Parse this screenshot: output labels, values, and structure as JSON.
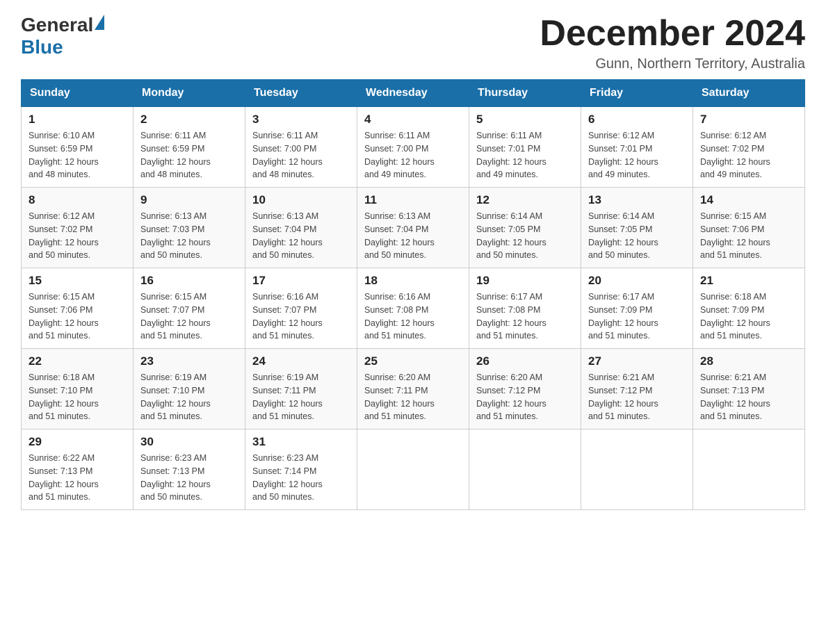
{
  "logo": {
    "general": "General",
    "blue": "Blue"
  },
  "title": "December 2024",
  "location": "Gunn, Northern Territory, Australia",
  "days_of_week": [
    "Sunday",
    "Monday",
    "Tuesday",
    "Wednesday",
    "Thursday",
    "Friday",
    "Saturday"
  ],
  "weeks": [
    [
      {
        "day": "1",
        "sunrise": "6:10 AM",
        "sunset": "6:59 PM",
        "daylight": "12 hours and 48 minutes."
      },
      {
        "day": "2",
        "sunrise": "6:11 AM",
        "sunset": "6:59 PM",
        "daylight": "12 hours and 48 minutes."
      },
      {
        "day": "3",
        "sunrise": "6:11 AM",
        "sunset": "7:00 PM",
        "daylight": "12 hours and 48 minutes."
      },
      {
        "day": "4",
        "sunrise": "6:11 AM",
        "sunset": "7:00 PM",
        "daylight": "12 hours and 49 minutes."
      },
      {
        "day": "5",
        "sunrise": "6:11 AM",
        "sunset": "7:01 PM",
        "daylight": "12 hours and 49 minutes."
      },
      {
        "day": "6",
        "sunrise": "6:12 AM",
        "sunset": "7:01 PM",
        "daylight": "12 hours and 49 minutes."
      },
      {
        "day": "7",
        "sunrise": "6:12 AM",
        "sunset": "7:02 PM",
        "daylight": "12 hours and 49 minutes."
      }
    ],
    [
      {
        "day": "8",
        "sunrise": "6:12 AM",
        "sunset": "7:02 PM",
        "daylight": "12 hours and 50 minutes."
      },
      {
        "day": "9",
        "sunrise": "6:13 AM",
        "sunset": "7:03 PM",
        "daylight": "12 hours and 50 minutes."
      },
      {
        "day": "10",
        "sunrise": "6:13 AM",
        "sunset": "7:04 PM",
        "daylight": "12 hours and 50 minutes."
      },
      {
        "day": "11",
        "sunrise": "6:13 AM",
        "sunset": "7:04 PM",
        "daylight": "12 hours and 50 minutes."
      },
      {
        "day": "12",
        "sunrise": "6:14 AM",
        "sunset": "7:05 PM",
        "daylight": "12 hours and 50 minutes."
      },
      {
        "day": "13",
        "sunrise": "6:14 AM",
        "sunset": "7:05 PM",
        "daylight": "12 hours and 50 minutes."
      },
      {
        "day": "14",
        "sunrise": "6:15 AM",
        "sunset": "7:06 PM",
        "daylight": "12 hours and 51 minutes."
      }
    ],
    [
      {
        "day": "15",
        "sunrise": "6:15 AM",
        "sunset": "7:06 PM",
        "daylight": "12 hours and 51 minutes."
      },
      {
        "day": "16",
        "sunrise": "6:15 AM",
        "sunset": "7:07 PM",
        "daylight": "12 hours and 51 minutes."
      },
      {
        "day": "17",
        "sunrise": "6:16 AM",
        "sunset": "7:07 PM",
        "daylight": "12 hours and 51 minutes."
      },
      {
        "day": "18",
        "sunrise": "6:16 AM",
        "sunset": "7:08 PM",
        "daylight": "12 hours and 51 minutes."
      },
      {
        "day": "19",
        "sunrise": "6:17 AM",
        "sunset": "7:08 PM",
        "daylight": "12 hours and 51 minutes."
      },
      {
        "day": "20",
        "sunrise": "6:17 AM",
        "sunset": "7:09 PM",
        "daylight": "12 hours and 51 minutes."
      },
      {
        "day": "21",
        "sunrise": "6:18 AM",
        "sunset": "7:09 PM",
        "daylight": "12 hours and 51 minutes."
      }
    ],
    [
      {
        "day": "22",
        "sunrise": "6:18 AM",
        "sunset": "7:10 PM",
        "daylight": "12 hours and 51 minutes."
      },
      {
        "day": "23",
        "sunrise": "6:19 AM",
        "sunset": "7:10 PM",
        "daylight": "12 hours and 51 minutes."
      },
      {
        "day": "24",
        "sunrise": "6:19 AM",
        "sunset": "7:11 PM",
        "daylight": "12 hours and 51 minutes."
      },
      {
        "day": "25",
        "sunrise": "6:20 AM",
        "sunset": "7:11 PM",
        "daylight": "12 hours and 51 minutes."
      },
      {
        "day": "26",
        "sunrise": "6:20 AM",
        "sunset": "7:12 PM",
        "daylight": "12 hours and 51 minutes."
      },
      {
        "day": "27",
        "sunrise": "6:21 AM",
        "sunset": "7:12 PM",
        "daylight": "12 hours and 51 minutes."
      },
      {
        "day": "28",
        "sunrise": "6:21 AM",
        "sunset": "7:13 PM",
        "daylight": "12 hours and 51 minutes."
      }
    ],
    [
      {
        "day": "29",
        "sunrise": "6:22 AM",
        "sunset": "7:13 PM",
        "daylight": "12 hours and 51 minutes."
      },
      {
        "day": "30",
        "sunrise": "6:23 AM",
        "sunset": "7:13 PM",
        "daylight": "12 hours and 50 minutes."
      },
      {
        "day": "31",
        "sunrise": "6:23 AM",
        "sunset": "7:14 PM",
        "daylight": "12 hours and 50 minutes."
      },
      null,
      null,
      null,
      null
    ]
  ],
  "labels": {
    "sunrise": "Sunrise:",
    "sunset": "Sunset:",
    "daylight": "Daylight:"
  }
}
